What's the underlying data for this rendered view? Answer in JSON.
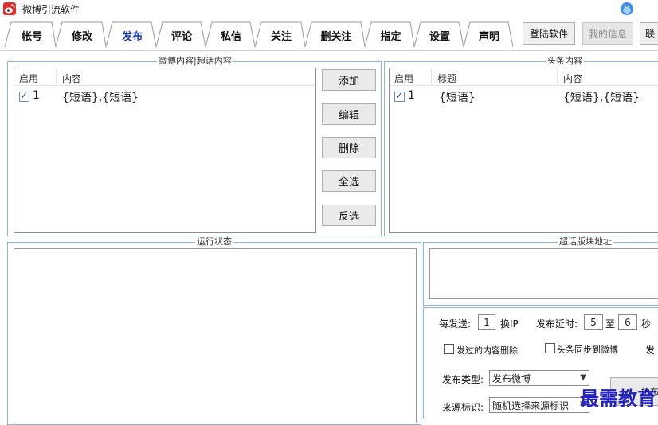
{
  "window": {
    "title": "微博引流软件"
  },
  "tabs": [
    {
      "label": "帐号",
      "active": false
    },
    {
      "label": "修改",
      "active": false
    },
    {
      "label": "发布",
      "active": true
    },
    {
      "label": "评论",
      "active": false
    },
    {
      "label": "私信",
      "active": false
    },
    {
      "label": "关注",
      "active": false
    },
    {
      "label": "删关注",
      "active": false
    },
    {
      "label": "指定",
      "active": false
    },
    {
      "label": "设置",
      "active": false
    },
    {
      "label": "声明",
      "active": false
    }
  ],
  "top_buttons": {
    "login": "登陆软件",
    "my_info": "我的信息",
    "cut_off": "联"
  },
  "weibo_group": {
    "title": "微博内容|超话内容",
    "columns": [
      "启用",
      "内容"
    ],
    "rows": [
      {
        "checked": true,
        "index": "1",
        "content": "{短语},{短语}"
      }
    ]
  },
  "side_buttons": [
    "添加",
    "编辑",
    "删除",
    "全选",
    "反选"
  ],
  "headline_group": {
    "title": "头条内容",
    "columns": [
      "启用",
      "标题",
      "内容"
    ],
    "rows": [
      {
        "checked": true,
        "index": "1",
        "title": "{短语}",
        "content": "{短语},{短语}"
      }
    ]
  },
  "status_group": {
    "title": "运行状态"
  },
  "topic_group": {
    "title": "超话版块地址"
  },
  "settings": {
    "per_send_label": "每发送:",
    "per_send_value": "1",
    "switch_ip_label": "换IP",
    "delay_label": "发布延时:",
    "delay_min": "5",
    "delay_to": "至",
    "delay_max": "6",
    "delay_unit": "秒",
    "delete_sent_label": "发过的内容删除",
    "delete_sent_checked": false,
    "sync_headline_label": "头条同步到微博",
    "sync_headline_checked": false,
    "cut_label": "发",
    "publish_type_label": "发布类型:",
    "publish_type_value": "发布微博",
    "source_label": "来源标识:",
    "source_value": "随机选择来源标识",
    "start_button_partial": "始布"
  },
  "watermark": "最需教育",
  "colors": {
    "group_border": "#8ab6d8",
    "active_tab": "#1a3fa8",
    "watermark": "#2323c8",
    "logo": "#e0302a"
  }
}
